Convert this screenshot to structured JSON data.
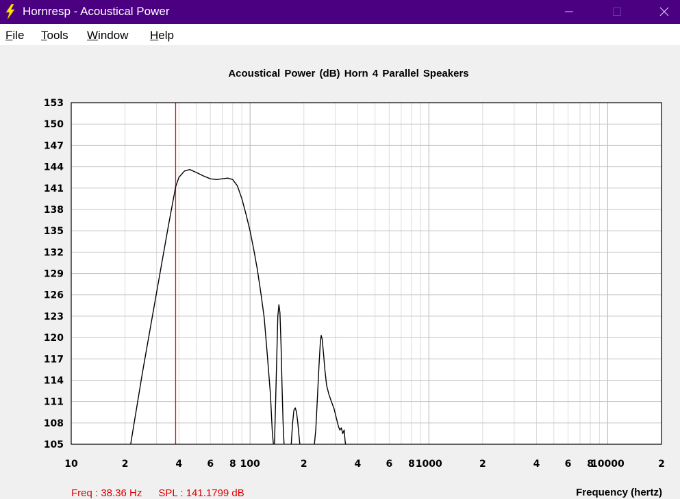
{
  "window": {
    "title": "Hornresp - Acoustical Power",
    "minimize_icon": "minimize-icon",
    "maximize_icon": "maximize-icon",
    "close_icon": "close-icon"
  },
  "menu": {
    "items": [
      {
        "label": "File",
        "accel": "F",
        "rest": "ile"
      },
      {
        "label": "Tools",
        "accel": "T",
        "rest": "ools"
      },
      {
        "label": "Window",
        "accel": "W",
        "rest": "indow"
      },
      {
        "label": "Help",
        "accel": "H",
        "rest": "elp"
      }
    ]
  },
  "readout": {
    "freq": "Freq : 38.36 Hz",
    "spl": "SPL : 141.1799 dB"
  },
  "chart_data": {
    "type": "line",
    "title": "Acoustical Power (dB)   Horn   4 Parallel Speakers",
    "xlabel": "Frequency (hertz)",
    "ylabel": "",
    "xscale": "log",
    "xlim": [
      10,
      20000
    ],
    "ylim": [
      105,
      153
    ],
    "yticks": [
      153,
      150,
      147,
      144,
      141,
      138,
      135,
      132,
      129,
      126,
      123,
      120,
      117,
      114,
      111,
      108,
      105
    ],
    "xtick_labels": [
      {
        "x": 10,
        "label": "10"
      },
      {
        "x": 20,
        "label": "2"
      },
      {
        "x": 40,
        "label": "4"
      },
      {
        "x": 60,
        "label": "6"
      },
      {
        "x": 80,
        "label": "8"
      },
      {
        "x": 100,
        "label": "100"
      },
      {
        "x": 200,
        "label": "2"
      },
      {
        "x": 400,
        "label": "4"
      },
      {
        "x": 600,
        "label": "6"
      },
      {
        "x": 800,
        "label": "8"
      },
      {
        "x": 1000,
        "label": "1000"
      },
      {
        "x": 2000,
        "label": "2"
      },
      {
        "x": 4000,
        "label": "4"
      },
      {
        "x": 6000,
        "label": "6"
      },
      {
        "x": 8000,
        "label": "8"
      },
      {
        "x": 10000,
        "label": "10000"
      },
      {
        "x": 20000,
        "label": "2"
      }
    ],
    "grid": true,
    "cursor": {
      "freq": 38.36,
      "spl": 141.1799,
      "color": "#ff0000"
    },
    "series": [
      {
        "color": "#000000",
        "segments": [
          [
            [
              21.5,
              105
            ],
            [
              25,
              115
            ],
            [
              30,
              126.3
            ],
            [
              35,
              135.8
            ],
            [
              38.36,
              141.18
            ],
            [
              40,
              142.5
            ],
            [
              43,
              143.4
            ],
            [
              46,
              143.6
            ],
            [
              50,
              143.2
            ],
            [
              55,
              142.7
            ],
            [
              60,
              142.3
            ],
            [
              65,
              142.2
            ],
            [
              70,
              142.3
            ],
            [
              75,
              142.4
            ],
            [
              80,
              142.2
            ],
            [
              85,
              141.3
            ],
            [
              90,
              139.5
            ],
            [
              95,
              137.3
            ],
            [
              100,
              135
            ],
            [
              105,
              132.3
            ],
            [
              110,
              129.5
            ],
            [
              115,
              126.2
            ],
            [
              120,
              122.8
            ],
            [
              125,
              117.5
            ],
            [
              130,
              112
            ],
            [
              133,
              107
            ],
            [
              135,
              105
            ]
          ],
          [
            [
              137,
              105
            ],
            [
              139,
              111
            ],
            [
              141,
              117
            ],
            [
              143,
              123
            ],
            [
              145,
              124.6
            ],
            [
              147,
              123.5
            ],
            [
              149,
              119
            ],
            [
              151,
              113
            ],
            [
              153,
              108
            ],
            [
              155,
              105
            ]
          ],
          [
            [
              170,
              105
            ],
            [
              173,
              108
            ],
            [
              176,
              109.8
            ],
            [
              179,
              110.1
            ],
            [
              182,
              109.5
            ],
            [
              185,
              108
            ],
            [
              189,
              105.5
            ],
            [
              190,
              105
            ]
          ],
          [
            [
              229,
              105
            ],
            [
              233,
              107
            ],
            [
              238,
              111.5
            ],
            [
              243,
              116
            ],
            [
              247,
              119.2
            ],
            [
              250,
              120.3
            ],
            [
              253,
              119.8
            ],
            [
              257,
              118
            ],
            [
              262,
              115.5
            ],
            [
              268,
              113.3
            ],
            [
              276,
              112
            ],
            [
              285,
              111
            ],
            [
              295,
              110
            ],
            [
              305,
              108.5
            ],
            [
              312,
              107.5
            ],
            [
              318,
              107
            ],
            [
              324,
              107.3
            ],
            [
              330,
              106.5
            ],
            [
              336,
              107
            ],
            [
              340,
              105.5
            ],
            [
              342,
              105
            ]
          ]
        ]
      }
    ]
  }
}
